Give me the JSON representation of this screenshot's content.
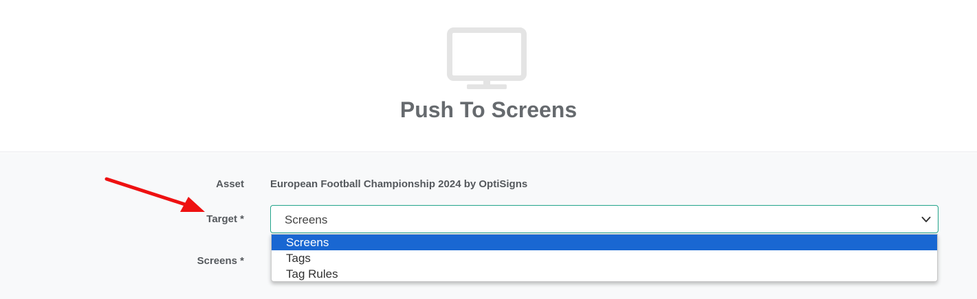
{
  "header": {
    "icon": "monitor-icon",
    "title": "Push To Screens"
  },
  "form": {
    "asset_label": "Asset",
    "asset_value": "European Football Championship 2024 by OptiSigns",
    "target_label": "Target *",
    "target_selected": "Screens",
    "screens_label": "Screens *"
  },
  "dropdown": {
    "options": [
      "Screens",
      "Tags",
      "Tag Rules"
    ],
    "selected_index": 0
  },
  "annotation": {
    "icon": "red-arrow-icon",
    "color": "#ee1111"
  },
  "colors": {
    "accent_border": "#22a38a",
    "selected_option": "#1967d2"
  }
}
